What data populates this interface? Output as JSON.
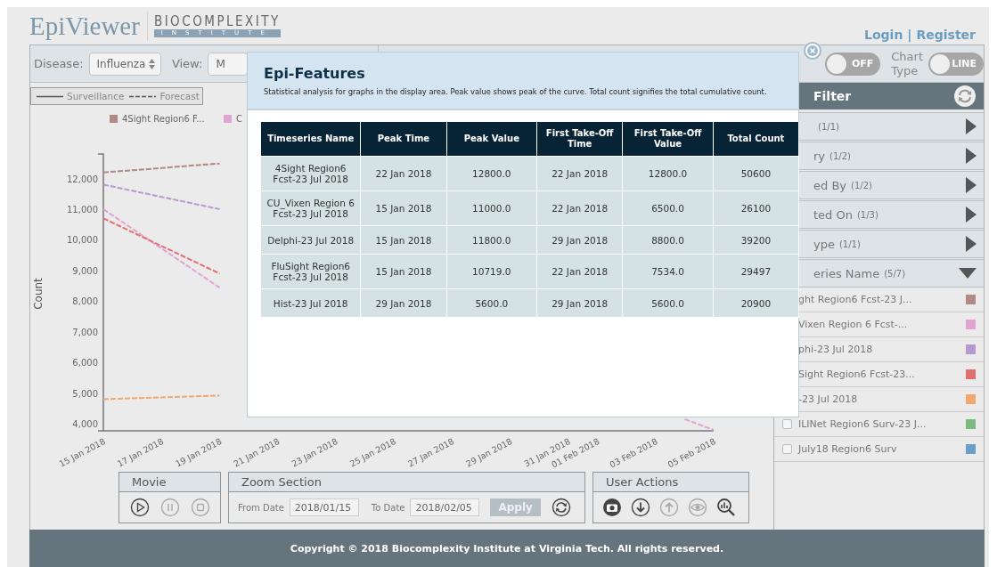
{
  "header": {
    "app_name": "EpiViewer",
    "org_name": "BIOCOMPLEXITY",
    "org_sub": "INSTITUTE",
    "login": "Login",
    "separator": "|",
    "register": "Register"
  },
  "toolbar": {
    "disease_label": "Disease:",
    "disease_value": "Influenza",
    "view_label": "View:",
    "view_value": "M",
    "toggles": [
      {
        "label": "OFF",
        "on": false
      },
      {
        "caption": "Chart Type",
        "label": "LINE",
        "on": false
      }
    ]
  },
  "line_key": [
    {
      "kind": "solid",
      "label": "Surveillance"
    },
    {
      "kind": "dashed",
      "label": "Forecast"
    }
  ],
  "legend": [
    {
      "label": "4Sight Region6 F...",
      "color": "#b08a85"
    },
    {
      "label": "C",
      "color": "#e2a3d3"
    }
  ],
  "chart_data": {
    "type": "line",
    "ylabel": "Count",
    "ylim": [
      3770,
      12800
    ],
    "categories": [
      "15 Jan 2018",
      null,
      "17 Jan 2018",
      null,
      "19 Jan 2018",
      null,
      "21 Jan 2018",
      null,
      "23 Jan 2018",
      null,
      "25 Jan 2018",
      null,
      "27 Jan 2018",
      null,
      "29 Jan 2018",
      null,
      "31 Jan 2018",
      "01 Feb 2018",
      null,
      "03 Feb 2018",
      null,
      "05 Feb 2018"
    ],
    "yticks": [
      {
        "value": 4000,
        "label": "4,000"
      },
      {
        "value": 5000,
        "label": "5,000"
      },
      {
        "value": 6000,
        "label": "6,000"
      },
      {
        "value": 7000,
        "label": "7,000"
      },
      {
        "value": 8000,
        "label": "8,000"
      },
      {
        "value": 9000,
        "label": "9,000"
      },
      {
        "value": 10000,
        "label": "10,000"
      },
      {
        "value": 11000,
        "label": "11,000"
      },
      {
        "value": 12000,
        "label": "12,000"
      }
    ],
    "series": [
      {
        "color": "#b08a85",
        "line_style": "dashed",
        "values": [
          12200,
          12270,
          12340,
          12420,
          12490,
          null,
          null,
          null,
          null,
          null,
          null,
          null,
          null,
          null,
          null,
          null,
          null,
          null,
          null,
          null,
          null,
          null
        ]
      },
      {
        "color": "#b59ad0",
        "line_style": "dashed",
        "values": [
          11800,
          11600,
          11400,
          11200,
          11000,
          null,
          null,
          null,
          null,
          null,
          null,
          null,
          null,
          null,
          null,
          null,
          null,
          null,
          null,
          null,
          null,
          null
        ]
      },
      {
        "color": "#e2a3d3",
        "line_style": "dashed",
        "values": [
          11000,
          10360,
          9720,
          9080,
          8440,
          null,
          null,
          null,
          null,
          null,
          null,
          null,
          null,
          null,
          null,
          null,
          null,
          null,
          null,
          null,
          4150,
          3800
        ]
      },
      {
        "color": "#e07070",
        "line_style": "dashed",
        "values": [
          10700,
          10250,
          9800,
          9350,
          8900,
          null,
          null,
          null,
          null,
          null,
          null,
          null,
          null,
          null,
          null,
          null,
          null,
          null,
          null,
          null,
          null,
          null
        ]
      },
      {
        "color": "#f0a870",
        "line_style": "dashed",
        "values": [
          4800,
          4830,
          4860,
          4890,
          4920,
          null,
          null,
          null,
          null,
          null,
          null,
          null,
          null,
          null,
          null,
          null,
          null,
          null,
          null,
          null,
          null,
          null
        ]
      }
    ]
  },
  "movie": {
    "title": "Movie",
    "buttons": [
      {
        "kind": "play",
        "disabled": false
      },
      {
        "kind": "pause",
        "disabled": true
      },
      {
        "kind": "stop",
        "disabled": true
      }
    ]
  },
  "zoom": {
    "title": "Zoom Section",
    "from_label": "From Date",
    "from_value": "2018/01/15",
    "to_label": "To Date",
    "to_value": "2018/02/05",
    "apply": "Apply"
  },
  "actions": {
    "title": "User Actions",
    "buttons": [
      {
        "kind": "camera",
        "disabled": false
      },
      {
        "kind": "download",
        "disabled": false
      },
      {
        "kind": "upload",
        "disabled": true
      },
      {
        "kind": "eye",
        "disabled": true
      },
      {
        "kind": "analyze",
        "disabled": false
      }
    ]
  },
  "filter": {
    "title": "Filter",
    "sections": [
      {
        "count": "(1/1)",
        "expanded": false
      },
      {
        "label": "ry",
        "count": "(1/2)",
        "expanded": false
      },
      {
        "label": "ed By",
        "count": "(1/2)",
        "expanded": false
      },
      {
        "label": "ted On",
        "count": "(1/3)",
        "expanded": false
      },
      {
        "label": "ype",
        "count": "(1/1)",
        "expanded": false
      },
      {
        "label": "eries Name",
        "count": "(5/7)",
        "expanded": true,
        "items": [
          {
            "label": "ght Region6 Fcst-23 J...",
            "color": "#b08a85"
          },
          {
            "label": "Vixen Region 6 Fcst-...",
            "color": "#e2a3d3"
          },
          {
            "label": "phi-23 Jul 2018",
            "color": "#b59ad0"
          },
          {
            "label": "Sight Region6 Fcst-23...",
            "color": "#e07070"
          },
          {
            "label": "-23 Jul 2018",
            "color": "#f0a870"
          },
          {
            "label": "ILINet Region6 Surv-23 J...",
            "color": "#7dba7d",
            "checked": false
          },
          {
            "label": "July18 Region6 Surv",
            "color": "#6a9fcc",
            "checked": false
          }
        ]
      }
    ]
  },
  "footer": "Copyright © 2018 Biocomplexity Institute at Virginia Tech. All rights reserved.",
  "modal": {
    "title": "Epi-Features",
    "description": "Statistical analysis for graphs in the display area. Peak value shows peak of the curve. Total count signifies the total cumulative count.",
    "columns": [
      "Timeseries Name",
      "Peak Time",
      "Peak Value",
      "First Take-Off Time",
      "First Take-Off Value",
      "Total Count"
    ],
    "rows": [
      [
        "4Sight Region6 Fcst-23 Jul 2018",
        "22 Jan 2018",
        "12800.0",
        "22 Jan 2018",
        "12800.0",
        "50600"
      ],
      [
        "CU_Vixen Region 6 Fcst-23 Jul 2018",
        "15 Jan 2018",
        "11000.0",
        "22 Jan 2018",
        "6500.0",
        "26100"
      ],
      [
        "Delphi-23 Jul 2018",
        "15 Jan 2018",
        "11800.0",
        "29 Jan 2018",
        "8800.0",
        "39200"
      ],
      [
        "FluSight Region6 Fcst-23 Jul 2018",
        "15 Jan 2018",
        "10719.0",
        "22 Jan 2018",
        "7534.0",
        "29497"
      ],
      [
        "Hist-23 Jul 2018",
        "29 Jan 2018",
        "5600.0",
        "29 Jan 2018",
        "5600.0",
        "20900"
      ]
    ]
  }
}
